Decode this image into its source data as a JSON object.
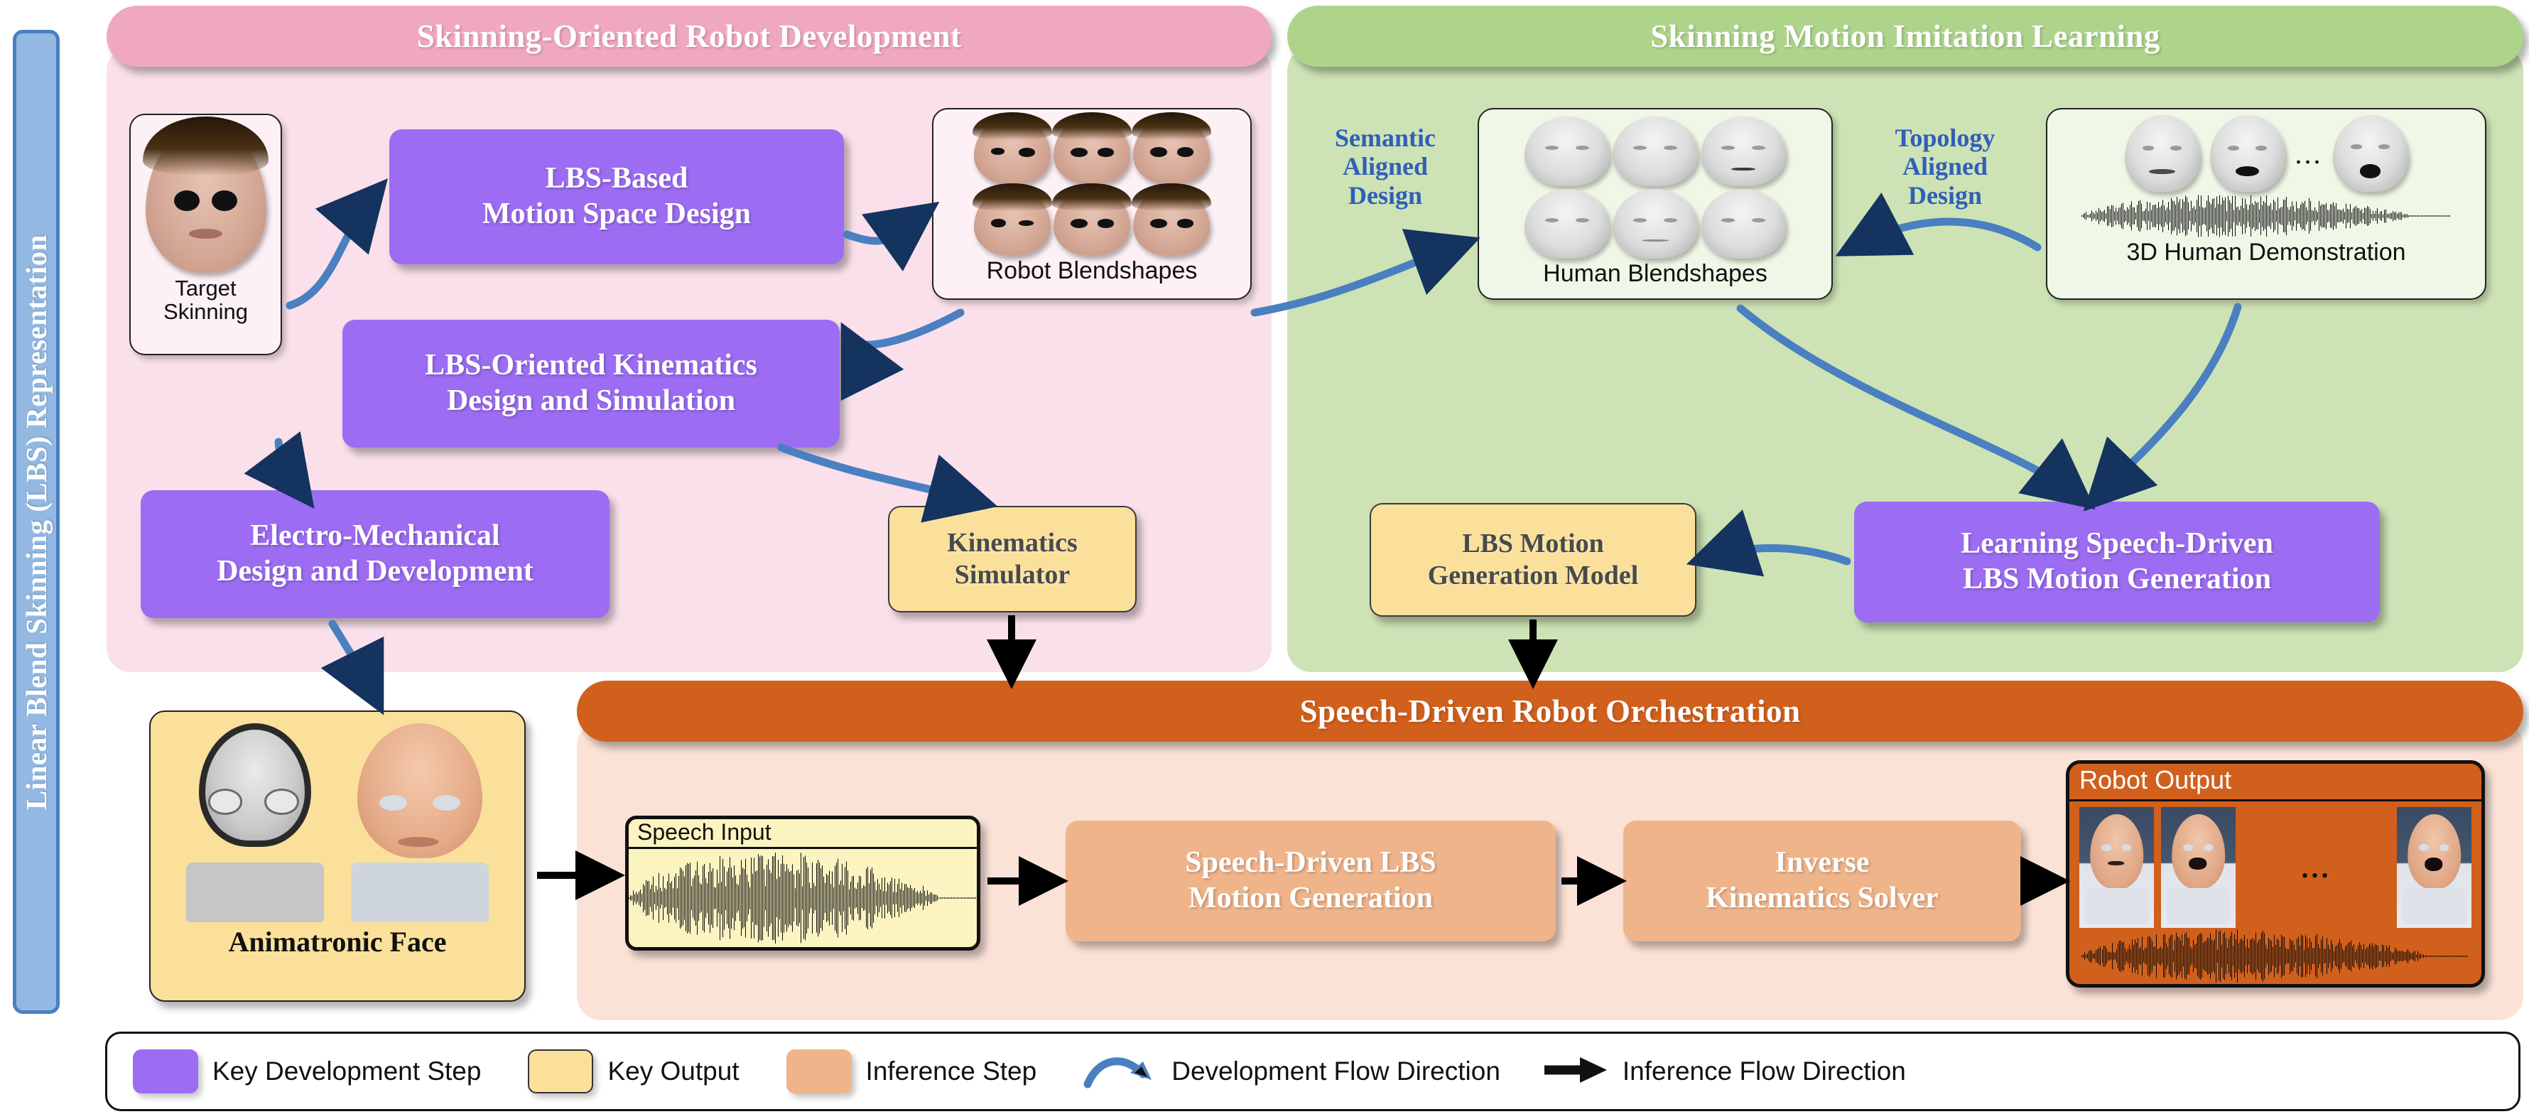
{
  "sidebar": {
    "label": "Linear Blend Skinning (LBS) Representation"
  },
  "sections": {
    "development": {
      "title": "Skinning-Oriented Robot Development"
    },
    "imitation": {
      "title": "Skinning Motion Imitation Learning"
    },
    "orchestration": {
      "title": "Speech-Driven Robot Orchestration"
    }
  },
  "development": {
    "target_card": {
      "caption_line1": "Target",
      "caption_line2": "Skinning"
    },
    "lbs_motion_box": {
      "line1": "LBS-Based",
      "line2": "Motion Space Design"
    },
    "lbs_kin_box": {
      "line1": "LBS-Oriented Kinematics",
      "line2": "Design and Simulation"
    },
    "electro_box": {
      "line1": "Electro-Mechanical",
      "line2": "Design and Development"
    },
    "robot_blendshapes_card": {
      "caption": "Robot Blendshapes"
    },
    "kinematics_simulator": {
      "line1": "Kinematics",
      "line2": "Simulator"
    }
  },
  "imitation": {
    "semantic_label": {
      "line1": "Semantic",
      "line2": "Aligned",
      "line3": "Design"
    },
    "topology_label": {
      "line1": "Topology",
      "line2": "Aligned",
      "line3": "Design"
    },
    "human_blendshapes_card": {
      "caption": "Human Blendshapes"
    },
    "human_demo_card": {
      "caption": "3D Human Demonstration",
      "ellipsis": "..."
    },
    "lbs_model_box": {
      "line1": "LBS Motion",
      "line2": "Generation Model"
    },
    "learning_box": {
      "line1": "Learning Speech-Driven",
      "line2": "LBS Motion Generation"
    }
  },
  "orchestration": {
    "animatronic_card": {
      "caption": "Animatronic Face"
    },
    "speech_input": {
      "title": "Speech Input"
    },
    "sd_lbs_box": {
      "line1": "Speech-Driven LBS",
      "line2": "Motion Generation"
    },
    "ik_box": {
      "line1": "Inverse",
      "line2": "Kinematics Solver"
    },
    "robot_output": {
      "title": "Robot Output",
      "ellipsis": "..."
    }
  },
  "legend": {
    "items": [
      {
        "label": "Key Development Step",
        "swatch": "#9c6cf2",
        "kind": "swatch"
      },
      {
        "label": "Key Output",
        "swatch": "#fbe09b",
        "kind": "swatch"
      },
      {
        "label": "Inference Step",
        "swatch": "#f0b48b",
        "kind": "swatch"
      },
      {
        "label": "Development Flow Direction",
        "swatch": "#4a7fc1",
        "kind": "curve-arrow"
      },
      {
        "label": "Inference Flow Direction",
        "swatch": "#111111",
        "kind": "straight-arrow"
      }
    ]
  },
  "colors": {
    "banner_fill": "#93b9e3",
    "banner_border": "#4a7fc1",
    "dev_header": "#f0a8c0",
    "dev_body": "#fae0ea",
    "imit_header": "#aed48c",
    "imit_body": "#cde3b5",
    "orch_header": "#d1601d",
    "orch_body": "#fbe2d7",
    "purple_step": "#9c6cf2",
    "yellow_output": "#fbe09b",
    "orange_step": "#f0b48b",
    "dev_arrow": "#4a7fc1",
    "inf_arrow": "#111111",
    "blue_text": "#2f5fb8"
  }
}
